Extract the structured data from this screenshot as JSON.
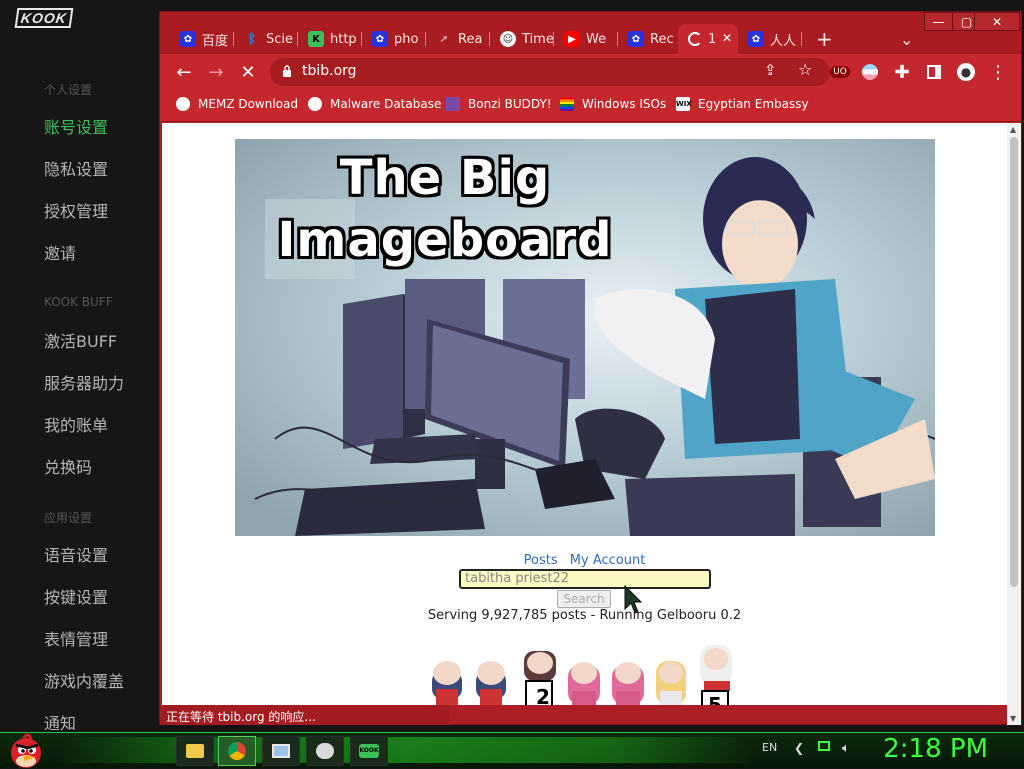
{
  "kook": {
    "logo": "KOOK",
    "sections": [
      {
        "title": "个人设置",
        "items": [
          "账号设置",
          "隐私设置",
          "授权管理",
          "邀请"
        ]
      },
      {
        "title": "KOOK BUFF",
        "items": [
          "激活BUFF",
          "服务器助力",
          "我的账单",
          "兑换码"
        ]
      },
      {
        "title": "应用设置",
        "items": [
          "语音设置",
          "按键设置",
          "表情管理",
          "游戏内覆盖",
          "通知"
        ]
      }
    ]
  },
  "browser": {
    "window_controls": {
      "minimize": "—",
      "maximize": "▢",
      "close": "✕"
    },
    "tabs": [
      {
        "label": "百度",
        "icon": "baidu-icon",
        "color": "#2932e1"
      },
      {
        "label": "Scie",
        "icon": "bing-icon",
        "color": "#1a8cd8"
      },
      {
        "label": "http",
        "icon": "kook-icon",
        "color": "#3dc05a"
      },
      {
        "label": "pho",
        "icon": "baidu-icon",
        "color": "#2932e1"
      },
      {
        "label": "Rea",
        "icon": "cursor-icon",
        "color": "#444444"
      },
      {
        "label": "Time",
        "icon": "clock-icon",
        "color": "#f5f5f5"
      },
      {
        "label": "We",
        "icon": "youtube-icon",
        "color": "#ff0000"
      },
      {
        "label": "Rec",
        "icon": "baidu-icon",
        "color": "#2932e1"
      },
      {
        "label": "1",
        "icon": "loading-icon",
        "color": "#c4272d"
      },
      {
        "label": "人人",
        "icon": "baidu-icon",
        "color": "#2932e1"
      }
    ],
    "new_tab": "+",
    "tab_search": "⌄",
    "url": "tbib.org",
    "bookmarks": [
      {
        "label": "MEMZ Download",
        "icon": "globe-icon"
      },
      {
        "label": "Malware Database",
        "icon": "globe-icon"
      },
      {
        "label": "Bonzi BUDDY!",
        "icon": "bonzi-icon"
      },
      {
        "label": "Windows ISOs",
        "icon": "rainbow-flag-icon"
      },
      {
        "label": "Egyptian Embassy",
        "icon": "wix-icon"
      }
    ],
    "status_text": "正在等待 tbib.org 的响应..."
  },
  "page": {
    "banner_title_line1": "The Big",
    "banner_title_line2": "Imageboard",
    "nav_posts": "Posts",
    "nav_account": "My Account",
    "search_value": "tabitha priest22",
    "search_button": "Search",
    "serving_text": "Serving 9,927,785 posts - Running Gelbooru 0.2",
    "counter_digits": [
      "2",
      "5"
    ]
  },
  "taskbar": {
    "language": "EN",
    "clock": "2:18 PM",
    "accent": "#3dff3d"
  }
}
